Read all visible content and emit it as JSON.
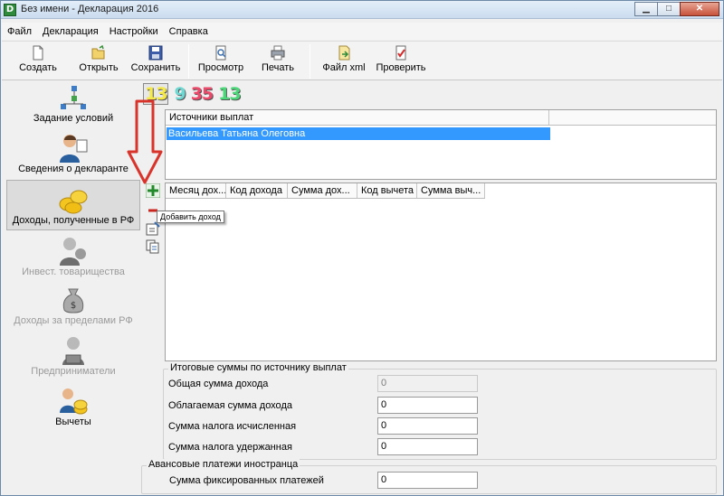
{
  "window": {
    "title": "Без имени - Декларация 2016",
    "app_icon": "D"
  },
  "menu": [
    "Файл",
    "Декларация",
    "Настройки",
    "Справка"
  ],
  "toolbar": {
    "create": "Создать",
    "open": "Открыть",
    "save": "Сохранить",
    "preview": "Просмотр",
    "print": "Печать",
    "xml": "Файл xml",
    "check": "Проверить"
  },
  "sidebar": [
    {
      "label": "Задание условий",
      "icon": "tree-icon",
      "state": "normal"
    },
    {
      "label": "Сведения о декларанте",
      "icon": "person-icon",
      "state": "normal"
    },
    {
      "label": "Доходы, полученные в РФ",
      "icon": "coins-icon",
      "state": "active"
    },
    {
      "label": "Инвест. товарищества",
      "icon": "investor-icon",
      "state": "disabled"
    },
    {
      "label": "Доходы за пределами РФ",
      "icon": "money-bag-icon",
      "state": "disabled"
    },
    {
      "label": "Предприниматели",
      "icon": "entrepreneur-icon",
      "state": "disabled"
    },
    {
      "label": "Вычеты",
      "icon": "deductions-icon",
      "state": "normal"
    }
  ],
  "rate_tabs": [
    {
      "label": "13",
      "color": "#f5e94a",
      "selected": true
    },
    {
      "label": "9",
      "color": "#6fd8d2",
      "selected": false
    },
    {
      "label": "35",
      "color": "#ec4a6a",
      "selected": false
    },
    {
      "label": "13",
      "color": "#4cd87a",
      "selected": false
    }
  ],
  "sources": {
    "header": "Источники выплат",
    "rows": [
      "Васильева Татьяна Олеговна"
    ]
  },
  "income_table": {
    "columns": [
      "Месяц дох...",
      "Код дохода",
      "Сумма дох...",
      "Код вычета",
      "Сумма выч..."
    ]
  },
  "tooltip": "Добавить доход",
  "totals": {
    "title": "Итоговые суммы по источнику выплат",
    "rows": [
      {
        "label": "Общая сумма дохода",
        "value": "0",
        "readonly": true
      },
      {
        "label": "Облагаемая сумма дохода",
        "value": "0",
        "readonly": false
      },
      {
        "label": "Сумма налога исчисленная",
        "value": "0",
        "readonly": false
      },
      {
        "label": "Сумма налога удержанная",
        "value": "0",
        "readonly": false
      }
    ]
  },
  "advance": {
    "title": "Авансовые платежи иностранца",
    "label": "Сумма фиксированных платежей",
    "value": "0"
  },
  "colors": {
    "selection": "#3399ff",
    "arrow": "#d9342b"
  }
}
